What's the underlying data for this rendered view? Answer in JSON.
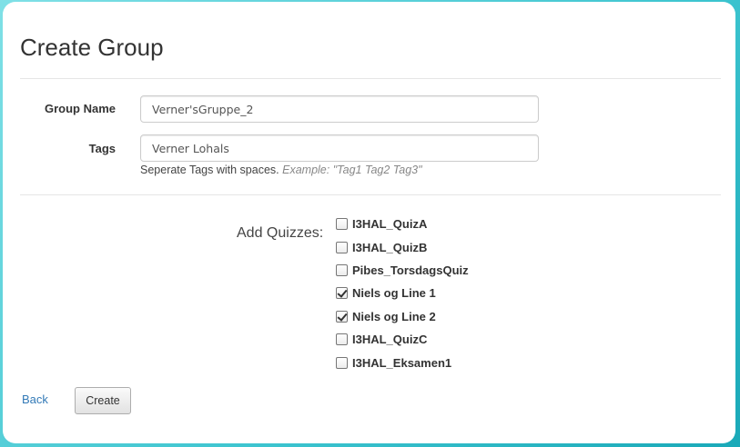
{
  "page": {
    "title": "Create Group"
  },
  "form": {
    "group_name": {
      "label": "Group Name",
      "value": "Verner'sGruppe_2"
    },
    "tags": {
      "label": "Tags",
      "value": "Verner Lohals",
      "help_text": "Seperate Tags with spaces.",
      "help_example": "Example: \"Tag1 Tag2 Tag3\""
    },
    "quizzes": {
      "label": "Add Quizzes:",
      "items": [
        {
          "name": "I3HAL_QuizA",
          "checked": false
        },
        {
          "name": "I3HAL_QuizB",
          "checked": false
        },
        {
          "name": "Pibes_TorsdagsQuiz",
          "checked": false
        },
        {
          "name": "Niels og Line 1",
          "checked": true
        },
        {
          "name": "Niels og Line 2",
          "checked": true
        },
        {
          "name": "I3HAL_QuizC",
          "checked": false
        },
        {
          "name": "I3HAL_Eksamen1",
          "checked": false
        }
      ]
    }
  },
  "actions": {
    "back_label": "Back",
    "create_label": "Create"
  },
  "colors": {
    "link": "#337ab7",
    "background_accent": "#3cc4cf"
  }
}
